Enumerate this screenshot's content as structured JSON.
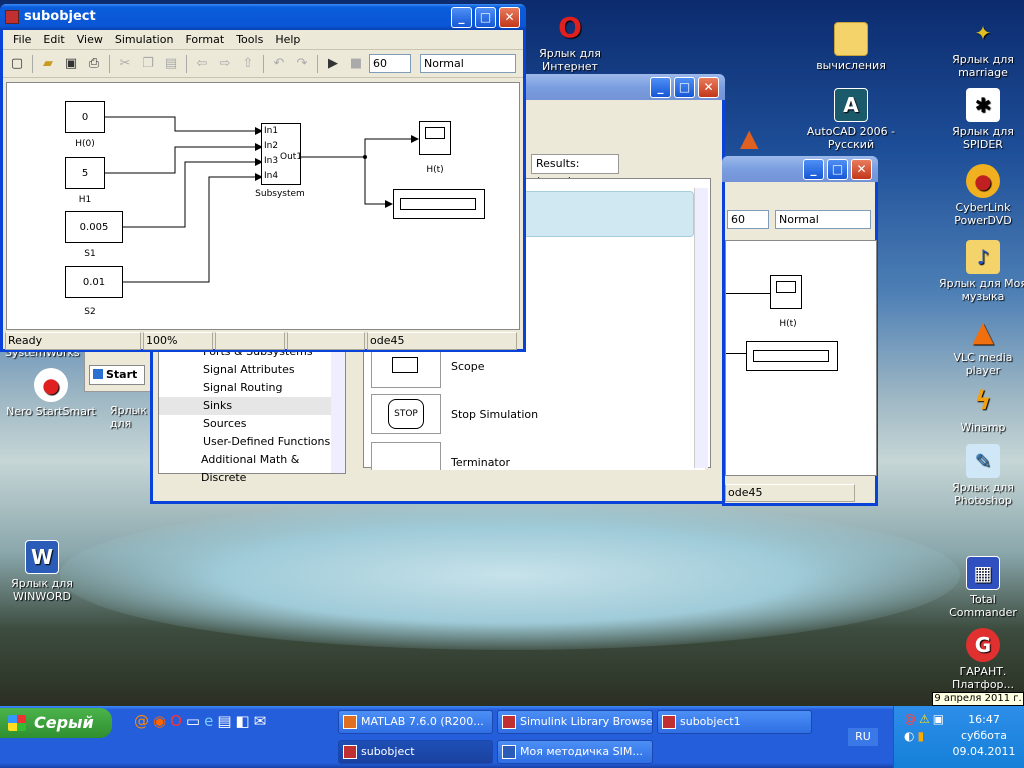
{
  "colors": {
    "xp_blue": "#0842d8",
    "title_active": "#0a5ddc",
    "face": "#ece9d8",
    "start_green": "#2f8f2f"
  },
  "desktop_icons": {
    "opera": {
      "label": "Ярлык для Интернет",
      "icon": "opera-icon"
    },
    "vychisleniya": {
      "label": "вычисления",
      "icon": "folder-icon"
    },
    "marriage": {
      "label": "Ярлык для marriage",
      "icon": "shortcut-icon"
    },
    "autocad": {
      "label": "AutoCAD 2006 - Русский",
      "icon": "autocad-icon"
    },
    "spider": {
      "label": "Ярлык для SPIDER",
      "icon": "spider-icon"
    },
    "cyberlink": {
      "label": "CyberLink PowerDVD",
      "icon": "dvd-icon"
    },
    "music": {
      "label": "Ярлык для Моя музыка",
      "icon": "music-folder-icon"
    },
    "vlc": {
      "label": "VLC media player",
      "icon": "vlc-icon"
    },
    "winamp": {
      "label": "Winamp",
      "icon": "winamp-icon"
    },
    "photoshop": {
      "label": "Ярлык для Photoshop",
      "icon": "photoshop-icon"
    },
    "nero": {
      "label": "Nero StartSmart",
      "icon": "nero-icon"
    },
    "winword": {
      "label": "Ярлык для WINWORD",
      "icon": "word-icon"
    },
    "totalcmd": {
      "label": "Total Commander",
      "icon": "floppy-icon"
    },
    "garant": {
      "label": "ГАРАНТ. Платфор...",
      "icon": "garant-icon"
    },
    "partial1": {
      "label": "SystemWorks"
    },
    "partial2": {
      "label": "Ярлык для"
    }
  },
  "subobject_window": {
    "title": "subobject",
    "menu": [
      "File",
      "Edit",
      "View",
      "Simulation",
      "Format",
      "Tools",
      "Help"
    ],
    "stop_time": "60",
    "sim_mode": "Normal",
    "blocks": {
      "const_h0": {
        "value": "0",
        "label": "H(0)"
      },
      "const_h1": {
        "value": "5",
        "label": "H1"
      },
      "const_s1": {
        "value": "0.005",
        "label": "S1"
      },
      "const_s2": {
        "value": "0.01",
        "label": "S2"
      },
      "subsystem": {
        "label": "Subsystem",
        "ports_in": [
          "In1",
          "In2",
          "In3",
          "In4"
        ],
        "port_out": "Out1"
      },
      "scope": {
        "label": "H(t)"
      }
    },
    "status": {
      "ready": "Ready",
      "zoom": "100%",
      "solver": "ode45"
    }
  },
  "library_window": {
    "results_tab": "Results: (none)",
    "tree": [
      "Ports & Subsystems",
      "Signal Attributes",
      "Signal Routing",
      "Sinks",
      "Sources",
      "User-Defined Functions",
      "Additional Math & Discrete"
    ],
    "selected_tree": "Sinks",
    "blocks": [
      {
        "name": "Scope"
      },
      {
        "name": "Stop Simulation",
        "glyph": "STOP"
      },
      {
        "name": "Terminator"
      }
    ]
  },
  "subobject1_window": {
    "stop_time": "60",
    "sim_mode": "Normal",
    "scope_label": "H(t)",
    "solver": "ode45"
  },
  "partial_start": {
    "label": "Start"
  },
  "taskbar": {
    "start_label": "Серый",
    "tasks": [
      {
        "label": "MATLAB  7.6.0 (R200..."
      },
      {
        "label": "Simulink Library Browser"
      },
      {
        "label": "subobject1"
      },
      {
        "label": "subobject"
      },
      {
        "label": "Моя методичка SIM..."
      }
    ],
    "lang": "RU",
    "time": "16:47",
    "weekday": "суббота",
    "date": "09.04.2011",
    "tooltip": "9 апреля 2011 г."
  }
}
